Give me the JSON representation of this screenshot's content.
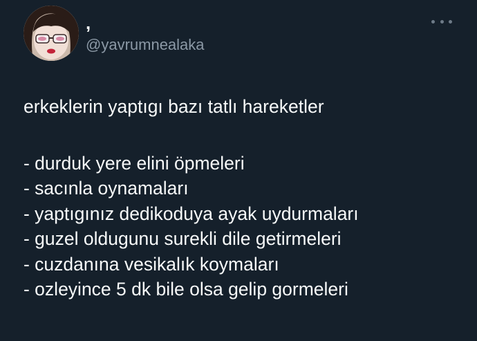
{
  "author": {
    "display_name": ",",
    "handle": "@yavrumnealaka"
  },
  "menu": {
    "icon": "more-horizontal-icon"
  },
  "tweet": {
    "title": "erkeklerin yaptıgı bazı tatlı hareketler",
    "items": [
      "- durduk yere elini öpmeleri",
      "- sacınla oynamaları",
      "- yaptıgınız dedikoduya ayak uydurmaları",
      "- guzel oldugunu surekli dile getirmeleri",
      "- cuzdanına vesikalık koymaları",
      "- ozleyince 5 dk bile olsa gelip gormeleri"
    ]
  },
  "colors": {
    "background": "#15202b",
    "text": "#f7f9f9",
    "secondary_text": "#8b98a5"
  }
}
